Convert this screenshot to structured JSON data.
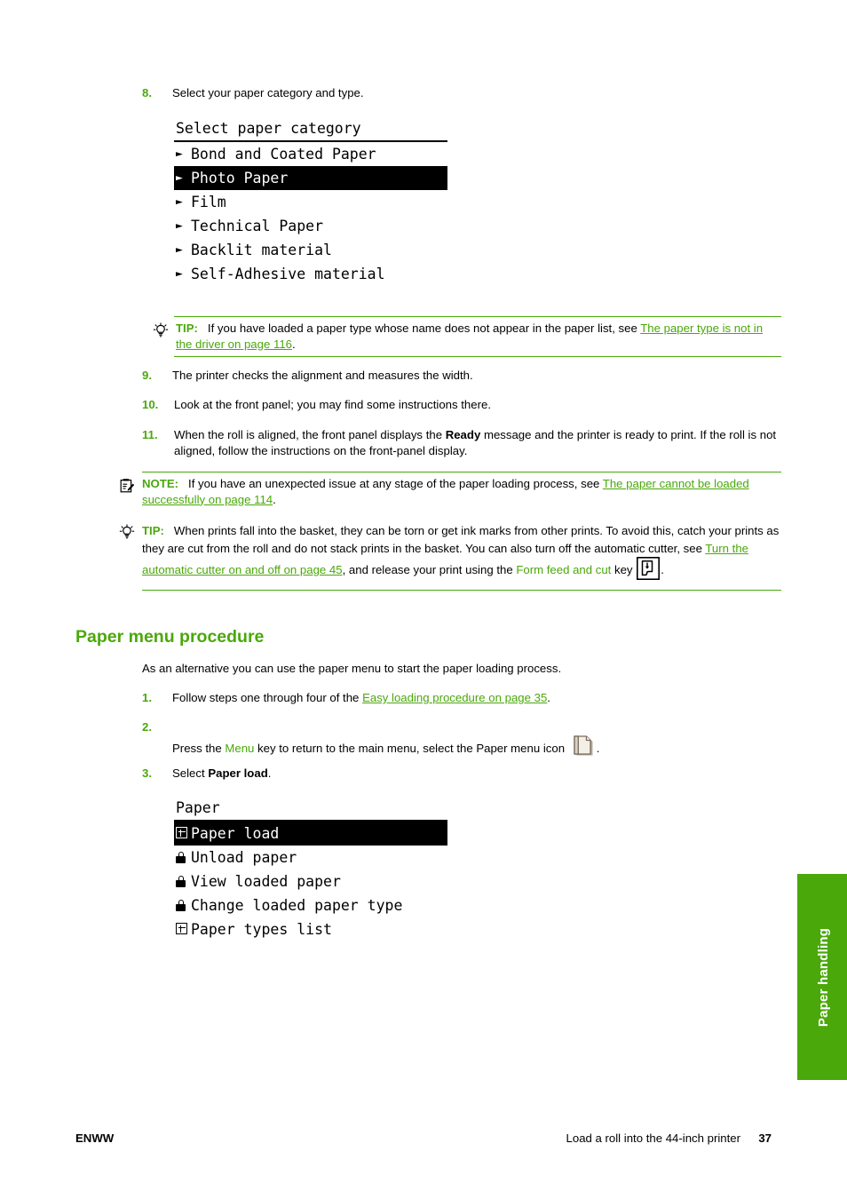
{
  "steps_continued": [
    {
      "number": "8.",
      "text": "Select your paper category and type."
    }
  ],
  "panel_category": {
    "title": "Select paper category",
    "items": [
      {
        "icon": "arrow",
        "label": "Bond and Coated Paper",
        "selected": false
      },
      {
        "icon": "arrow",
        "label": "Photo Paper",
        "selected": true
      },
      {
        "icon": "arrow",
        "label": "Film",
        "selected": false
      },
      {
        "icon": "arrow",
        "label": "Technical Paper",
        "selected": false
      },
      {
        "icon": "arrow",
        "label": "Backlit material",
        "selected": false
      },
      {
        "icon": "arrow",
        "label": "Self-Adhesive material",
        "selected": false
      }
    ]
  },
  "tip_paper_type": {
    "icon": "lightbulb-icon",
    "label": "TIP:",
    "text_before": "If you have loaded a paper type whose name does not appear in the paper list, see ",
    "link": "The paper type is not in the driver on page 116",
    "text_after": "."
  },
  "step9": {
    "number": "9.",
    "text": "The printer checks the alignment and measures the width."
  },
  "step10": {
    "number": "10.",
    "text": "Look at the front panel; you may find some instructions there."
  },
  "step11": {
    "number": "11.",
    "text_before": "When the roll is aligned, the front panel displays the ",
    "bold": "Ready",
    "text_after": " message and the printer is ready to print. If the roll is not aligned, follow the instructions on the front-panel display."
  },
  "note_loading": {
    "icon": "note-icon",
    "label": "NOTE:",
    "text_before": "If you have an unexpected issue at any stage of the paper loading process, see ",
    "link": "The paper cannot be loaded successfully on page 114",
    "text_after": "."
  },
  "tip_basket": {
    "icon": "lightbulb-icon",
    "label": "TIP:",
    "text_before": "When prints fall into the basket, they can be torn or get ink marks from other prints. To avoid this, catch your prints as they are cut from the roll and do not stack prints in the basket. You can also turn off the automatic cutter, see ",
    "link": "Turn the automatic cutter on and off on page 45",
    "text_mid": ", and release your print using the ",
    "uiref": "Form feed and cut",
    "text_after": " key ",
    "icon_inline": "form-feed-and-cut-key-icon",
    "text_end": "."
  },
  "heading": "Paper menu procedure",
  "intro": "As an alternative you can use the paper menu to start the paper loading process.",
  "menu_steps": {
    "step1": {
      "number": "1.",
      "text_before": "Follow steps one through four of the ",
      "link": "Easy loading procedure on page 35",
      "text_after": "."
    },
    "step2": {
      "number": "2.",
      "text_before": "Press the ",
      "uiref": "Menu",
      "text_mid": " key to return to the main menu, select the Paper menu icon ",
      "icon_inline": "paper-menu-icon",
      "text_after": "."
    },
    "step3": {
      "number": "3.",
      "text_before": "Select ",
      "bold": "Paper load",
      "text_after": "."
    }
  },
  "panel_paper": {
    "title": "Paper",
    "items": [
      {
        "icon": "plusbox",
        "label": "Paper load",
        "selected": true
      },
      {
        "icon": "lock",
        "label": "Unload paper",
        "selected": false
      },
      {
        "icon": "lock",
        "label": "View loaded paper",
        "selected": false
      },
      {
        "icon": "lock",
        "label": "Change loaded paper type",
        "selected": false
      },
      {
        "icon": "plusbox",
        "label": "Paper types list",
        "selected": false
      }
    ]
  },
  "side_tab": {
    "label": "Paper handling",
    "color": "#4aa80a"
  },
  "footer": {
    "left": "ENWW",
    "right_title": "Load a roll into the 44-inch printer",
    "page_number": "37"
  },
  "colors": {
    "accent_green": "#4aa80a",
    "link_green": "#4aa80a",
    "text_black": "#000000"
  }
}
